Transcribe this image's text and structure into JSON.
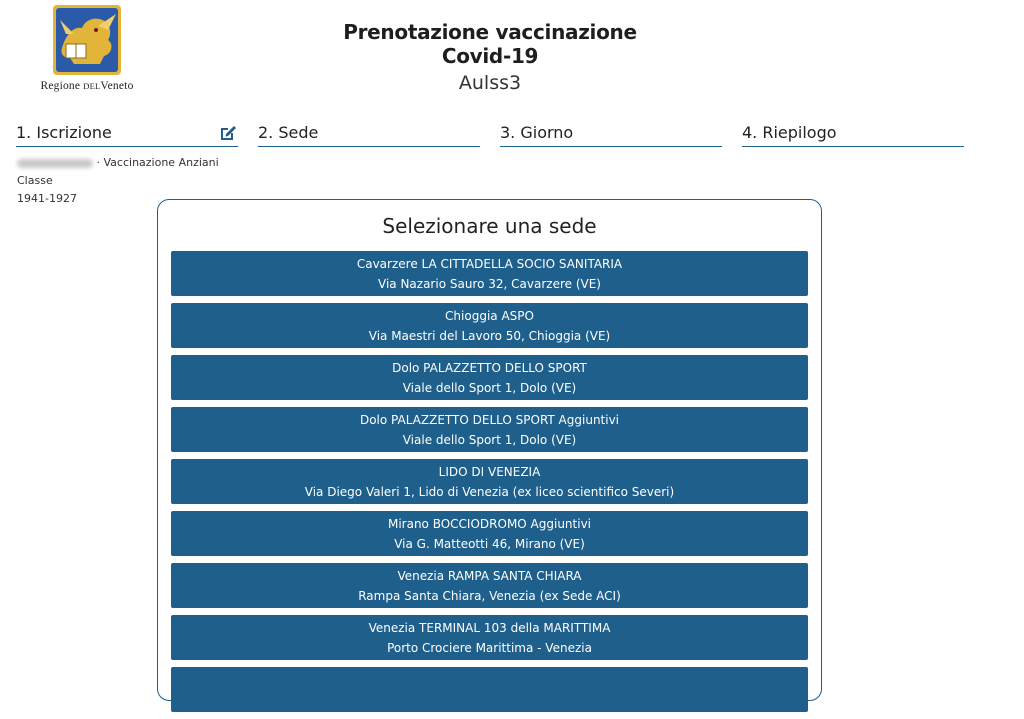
{
  "header": {
    "logo_text_main1": "Regione",
    "logo_text_small": "del",
    "logo_text_main2": "Veneto",
    "title": "Prenotazione vaccinazione Covid-19",
    "subtitle": "Aulss3"
  },
  "steps": [
    {
      "label": "1. Iscrizione"
    },
    {
      "label": "2. Sede"
    },
    {
      "label": "3. Giorno"
    },
    {
      "label": "4. Riepilogo"
    }
  ],
  "user_info": {
    "separator": " · ",
    "category_line1": "Vaccinazione Anziani Classe",
    "category_line2": "1941-1927"
  },
  "panel": {
    "title": "Selezionare una sede"
  },
  "sites": [
    {
      "name": "Cavarzere LA CITTADELLA SOCIO SANITARIA",
      "address": "Via Nazario Sauro 32, Cavarzere (VE)"
    },
    {
      "name": "Chioggia ASPO",
      "address": "Via Maestri del Lavoro 50, Chioggia (VE)"
    },
    {
      "name": "Dolo PALAZZETTO DELLO SPORT",
      "address": "Viale dello Sport 1, Dolo (VE)"
    },
    {
      "name": "Dolo PALAZZETTO DELLO SPORT Aggiuntivi",
      "address": "Viale dello Sport 1, Dolo (VE)"
    },
    {
      "name": "LIDO DI VENEZIA",
      "address": "Via Diego Valeri 1, Lido di Venezia (ex liceo scientifico Severi)"
    },
    {
      "name": "Mirano BOCCIODROMO Aggiuntivi",
      "address": "Via G. Matteotti 46, Mirano (VE)"
    },
    {
      "name": "Venezia RAMPA SANTA CHIARA",
      "address": "Rampa Santa Chiara, Venezia (ex Sede ACI)"
    },
    {
      "name": "Venezia TERMINAL 103 della MARITTIMA",
      "address": "Porto Crociere Marittima - Venezia"
    },
    {
      "name": "",
      "address": ""
    }
  ],
  "colors": {
    "primary": "#1f5f8b",
    "logo_gold": "#e2b53a",
    "logo_blue": "#2a5aa8"
  },
  "icons": {
    "edit": "edit-icon",
    "logo": "regione-veneto-logo"
  }
}
